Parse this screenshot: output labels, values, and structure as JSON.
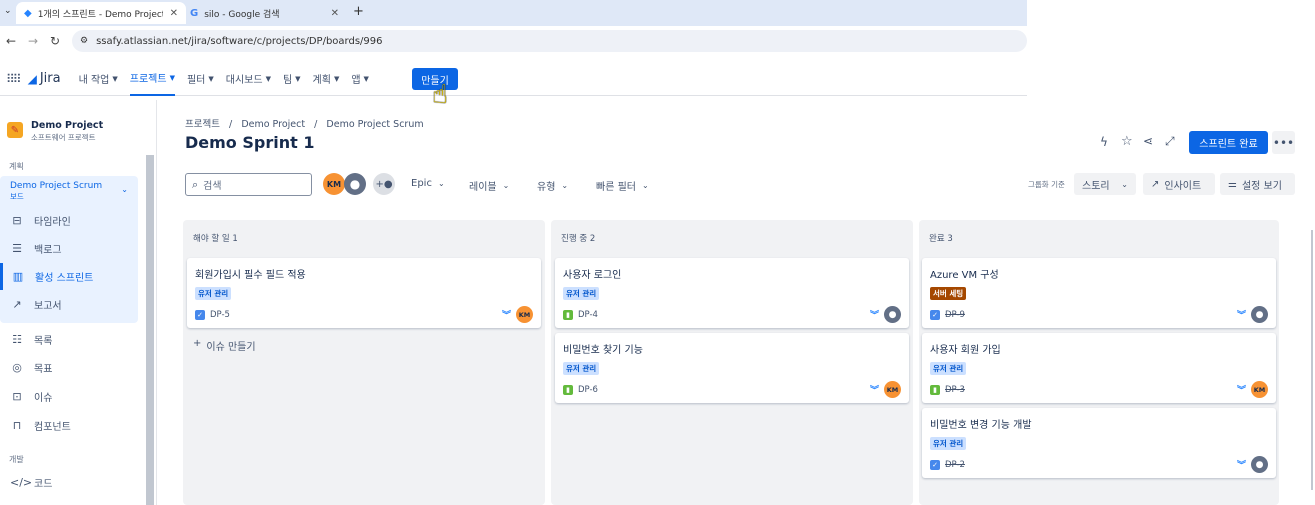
{
  "browser": {
    "tabs": [
      {
        "title": "1개의 스프린트 - Demo Project",
        "icon": "jira-icon"
      },
      {
        "title": "silo - Google 검색",
        "icon": "google-icon"
      }
    ],
    "url": "ssafy.atlassian.net/jira/software/c/projects/DP/boards/996"
  },
  "header": {
    "logo": "Jira",
    "menu": [
      "내 작업",
      "프로젝트",
      "필터",
      "대시보드",
      "팀",
      "계획",
      "앱"
    ],
    "create_label": "만들기"
  },
  "sidebar": {
    "project_name": "Demo Project",
    "project_type": "소프트웨어 프로젝트",
    "section_plan": "계획",
    "board_name": "Demo Project Scrum",
    "board_sub": "보드",
    "items": [
      "타임라인",
      "백로그",
      "활성 스프린트",
      "보고서",
      "목록",
      "목표",
      "이슈",
      "컴포넌트"
    ],
    "section_dev": "개발",
    "dev_items": [
      "코드"
    ]
  },
  "main": {
    "breadcrumb": [
      "프로젝트",
      "Demo Project",
      "Demo Project Scrum"
    ],
    "title": "Demo Sprint 1",
    "complete_sprint": "스프린트 완료",
    "search_placeholder": "검색",
    "avatar_initials": "KM",
    "filters": [
      "Epic",
      "레이블",
      "유형",
      "빠른 필터"
    ],
    "group_by_label": "그룹화 기준",
    "group_by_value": "스토리",
    "insights": "인사이트",
    "view_settings": "설정 보기",
    "create_issue": "이슈 만들기"
  },
  "columns": [
    {
      "header": "해야 할 일 1",
      "cards": [
        {
          "title": "회원가입시 필수 필드 적용",
          "label": "유저 관리",
          "key": "DP-5",
          "type": "task",
          "done": false,
          "assignee": "KM"
        }
      ]
    },
    {
      "header": "진행 중 2",
      "cards": [
        {
          "title": "사용자 로그인",
          "label": "유저 관리",
          "key": "DP-4",
          "type": "story",
          "done": false,
          "assignee": ""
        },
        {
          "title": "비밀번호 찾기 기능",
          "label": "유저 관리",
          "key": "DP-6",
          "type": "story",
          "done": false,
          "assignee": "KM"
        }
      ]
    },
    {
      "header": "완료 3",
      "cards": [
        {
          "title": "Azure VM 구성",
          "label": "서버 세팅",
          "key": "DP-9",
          "type": "task",
          "done": true,
          "assignee": ""
        },
        {
          "title": "사용자 회원 가입",
          "label": "유저 관리",
          "key": "DP-3",
          "type": "story",
          "done": true,
          "assignee": "KM"
        },
        {
          "title": "비밀번호 변경 기능 개발",
          "label": "유저 관리",
          "key": "DP-2",
          "type": "task",
          "done": true,
          "assignee": ""
        }
      ]
    }
  ],
  "colors": {
    "accent": "#0c66e4",
    "label_blue": "#cce0ff",
    "label_brown": "#a54800",
    "avatar": "#f79233"
  }
}
